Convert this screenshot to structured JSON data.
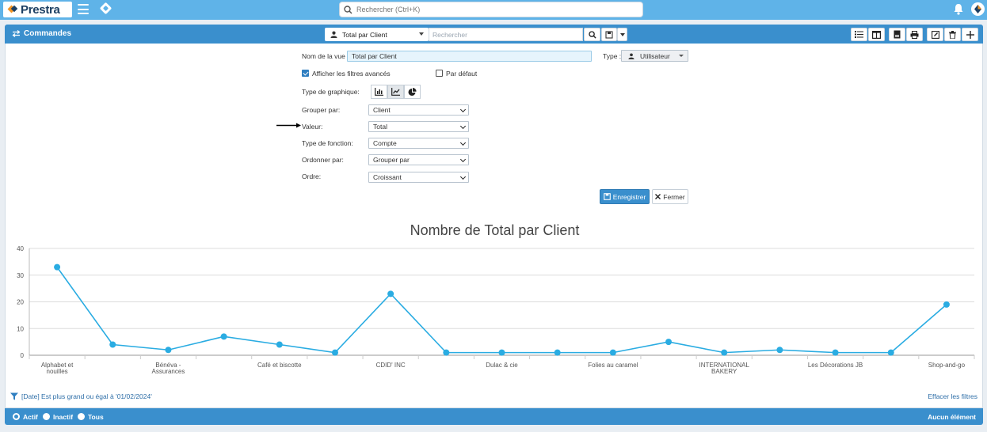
{
  "brand": {
    "name": "Prestra"
  },
  "topbar": {
    "search_placeholder": "Rechercher (Ctrl+K)"
  },
  "module": {
    "title": "Commandes",
    "view_name": "Total par Client",
    "search_placeholder": "Rechercher"
  },
  "form": {
    "view_name_label": "Nom de la vue :",
    "view_name_value": "Total par Client",
    "type_label": "Type :",
    "type_value": "Utilisateur",
    "show_filters_label": "Afficher les filtres avancés",
    "show_filters_checked": true,
    "default_label": "Par défaut",
    "default_checked": false,
    "chart_type_label": "Type de graphique:",
    "chart_types": [
      "bar-chart-icon",
      "line-chart-icon",
      "pie-chart-icon"
    ],
    "chart_type_selected": "line",
    "group_by_label": "Grouper par:",
    "group_by_value": "Client",
    "value_label": "Valeur:",
    "value_value": "Total",
    "function_label": "Type de fonction:",
    "function_value": "Compte",
    "order_by_label": "Ordonner par:",
    "order_by_value": "Grouper par",
    "order_label": "Ordre:",
    "order_value": "Croissant",
    "save_label": "Enregistrer",
    "close_label": "Fermer"
  },
  "chart_data": {
    "type": "line",
    "title": "Nombre de Total par Client",
    "categories": [
      "Alphabet et nouilles",
      "",
      "Bénéva - Assurances",
      "",
      "Café et biscotte",
      "",
      "CDID' INC",
      "",
      "Dulac & cie",
      "",
      "Folies au caramel",
      "",
      "INTERNATIONAL BAKERY",
      "",
      "Les Décorations JB",
      "",
      "Shop-and-go"
    ],
    "category_lines": [
      [
        "Alphabet et",
        "nouilles"
      ],
      [],
      [
        "Bénéva -",
        "Assurances"
      ],
      [],
      [
        "Café et biscotte"
      ],
      [],
      [
        "CDID' INC"
      ],
      [],
      [
        "Dulac & cie"
      ],
      [],
      [
        "Folies au caramel"
      ],
      [],
      [
        "INTERNATIONAL",
        "BAKERY"
      ],
      [],
      [
        "Les Décorations JB"
      ],
      [],
      [
        "Shop-and-go"
      ]
    ],
    "values": [
      33,
      4,
      2,
      7,
      4,
      1,
      23,
      1,
      1,
      1,
      1,
      5,
      1,
      2,
      1,
      1,
      19
    ],
    "ylim": [
      0,
      40
    ],
    "yticks": [
      "0",
      "10",
      "20",
      "30",
      "40"
    ],
    "grid": true,
    "color": "#2aace2"
  },
  "filter": {
    "text": "[Date] Est plus grand ou égal à '01/02/2024'",
    "clear_label": "Effacer les filtres"
  },
  "footer": {
    "radios": [
      "Actif",
      "Inactif",
      "Tous"
    ],
    "selected": "Actif",
    "status": "Aucun élément"
  },
  "colors": {
    "topbar": "#5fb3e8",
    "module": "#3a8fcd",
    "series": "#2aace2"
  }
}
